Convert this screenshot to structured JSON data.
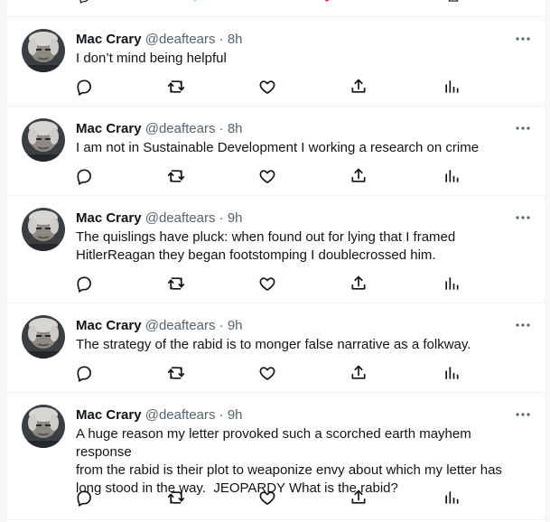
{
  "author": {
    "name": "Mac Crary",
    "handle": "@deaftears",
    "separator": "·"
  },
  "colors": {
    "text": "#0f1419",
    "muted": "#536471",
    "divider": "#eff3f4",
    "retweet_green": "#00ba7c",
    "like_pink": "#f91880"
  },
  "icons": [
    "reply-icon",
    "retweet-icon",
    "like-icon",
    "share-icon",
    "analytics-icon",
    "more-icon"
  ],
  "tweets": [
    {
      "time": "8h",
      "text": "I don’t mind being helpful"
    },
    {
      "time": "8h",
      "text": "I am not in Sustainable Development I working a research on crime"
    },
    {
      "time": "9h",
      "text": "The quislings have pluck: when found out for lying that I framed\nHitlerReagan they began footstomping I doublecrossed him."
    },
    {
      "time": "9h",
      "text": "The strategy of the rabid is to monger false narrative as a folkway."
    },
    {
      "time": "9h",
      "text": "A huge reason my letter provoked such a scorched earth mayhem response\nfrom the rabid is their plot to weaponize envy about which my letter has\nlong stood in the way.  JEOPARDY What is the rabid?"
    }
  ]
}
